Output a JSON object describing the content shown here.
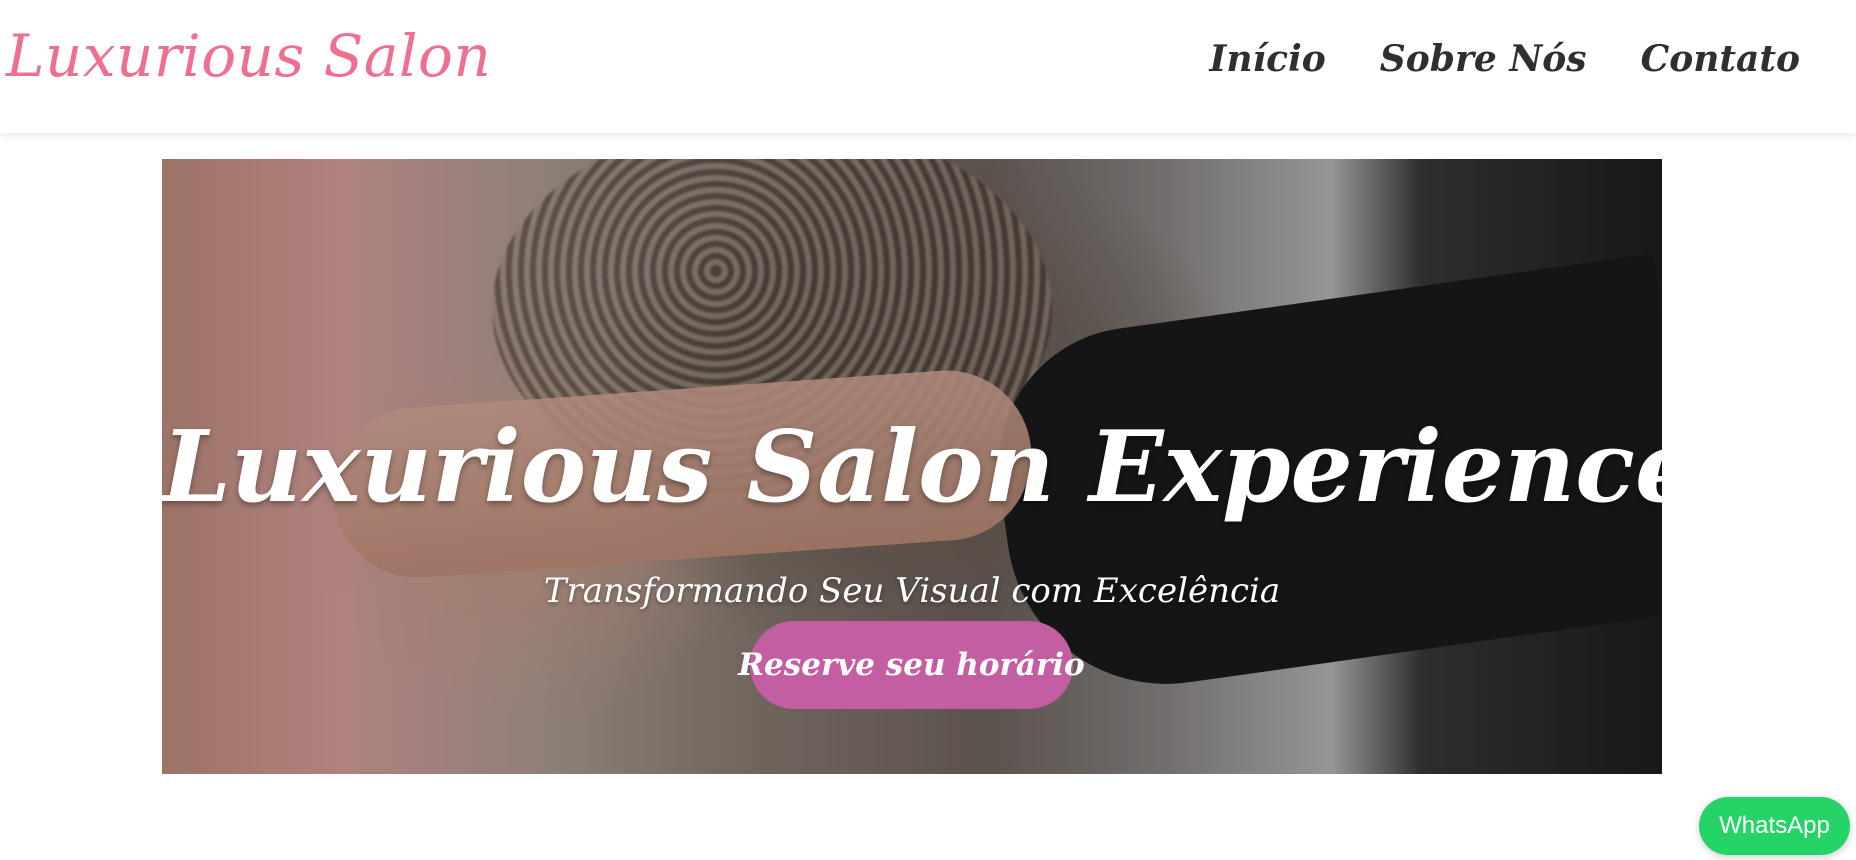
{
  "header": {
    "logo": "Luxurious Salon",
    "nav": [
      {
        "label": "Início"
      },
      {
        "label": "Sobre Nós"
      },
      {
        "label": "Contato"
      }
    ]
  },
  "hero": {
    "title": "Luxurious Salon Experience",
    "subtitle": "Transformando Seu Visual com Excelência",
    "cta_label": "Reserve seu horário"
  },
  "floating": {
    "whatsapp_label": "WhatsApp"
  },
  "colors": {
    "logo": "#ef6f8f",
    "cta": "#c45ea2",
    "whatsapp": "#25d366",
    "nav_text": "#2f2f2f"
  }
}
